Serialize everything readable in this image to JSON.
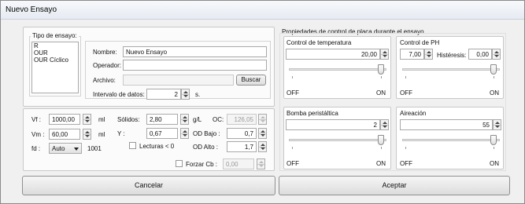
{
  "window": {
    "title": "Nuevo Ensayo"
  },
  "tipo": {
    "legend": "Tipo de ensayo:",
    "options": [
      "R",
      "OUR",
      "OUR Cíclico"
    ]
  },
  "form": {
    "nombre_label": "Nombre:",
    "nombre_value": "Nuevo Ensayo",
    "operador_label": "Operador:",
    "operador_value": "",
    "archivo_label": "Archivo:",
    "archivo_value": "",
    "buscar_label": "Buscar",
    "intervalo_label": "Intervalo de datos:",
    "intervalo_value": "2",
    "intervalo_unit": "s."
  },
  "params": {
    "vf_label": "Vf :",
    "vf_value": "1000,00",
    "vf_unit": "ml",
    "vm_label": "Vm :",
    "vm_value": "60,00",
    "vm_unit": "ml",
    "fd_label": "fd :",
    "fd_value": "Auto",
    "fd_extra": "1001",
    "solidos_label": "Sólidos:",
    "solidos_value": "2,80",
    "solidos_unit": "g/L",
    "y_label": "Y :",
    "y_value": "0,67",
    "oc_label": "OC:",
    "oc_value": "126,05",
    "odbajo_label": "OD Bajo :",
    "odbajo_value": "0,7",
    "odalto_label": "OD Alto :",
    "odalto_value": "1,7",
    "lecturas_label": "Lecturas < 0",
    "forzar_label": "Forzar Cb :",
    "forzar_value": "0,00"
  },
  "control": {
    "legend": "Propiedades de control de placa durante el ensayo",
    "temp": {
      "title": "Control de temperatura",
      "value": "20,00",
      "off": "OFF",
      "on": "ON"
    },
    "ph": {
      "title": "Control de PH",
      "value": "7,00",
      "histeresis_label": "Histéresis:",
      "histeresis_value": "0,00",
      "off": "OFF",
      "on": "ON"
    },
    "bomba": {
      "title": "Bomba peristáltica",
      "value": "2",
      "off": "OFF",
      "on": "ON"
    },
    "aireacion": {
      "title": "Aireación",
      "value": "55",
      "off": "OFF",
      "on": "ON"
    }
  },
  "buttons": {
    "cancel": "Cancelar",
    "accept": "Aceptar"
  }
}
